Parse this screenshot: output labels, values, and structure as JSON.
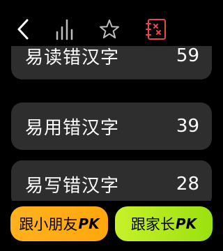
{
  "toolbar": {
    "back_icon": "back-chevron-icon",
    "chart_icon": "bar-chart-icon",
    "star_icon": "star-icon",
    "wrong_book_icon": "wrong-book-icon",
    "active_color": "#e5484d"
  },
  "list": {
    "items": [
      {
        "label": "易读错汉字",
        "count": "59"
      },
      {
        "label": "易用错汉字",
        "count": "39"
      },
      {
        "label": "易写错汉字",
        "count": "28"
      }
    ]
  },
  "bottom": {
    "kids_pk": {
      "label": "跟小朋友",
      "suffix": "PK",
      "color": "#ffab14"
    },
    "parent_pk": {
      "label": "跟家长",
      "suffix": "PK",
      "color": "#acea1a"
    }
  }
}
